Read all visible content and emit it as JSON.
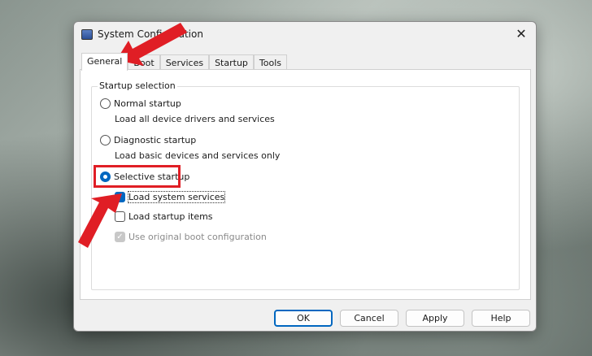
{
  "window": {
    "title": "System Configuration",
    "close_label": "✕"
  },
  "tabs": [
    {
      "label": "General"
    },
    {
      "label": "Boot"
    },
    {
      "label": "Services"
    },
    {
      "label": "Startup"
    },
    {
      "label": "Tools"
    }
  ],
  "startup_selection": {
    "label": "Startup selection",
    "normal": {
      "label": "Normal startup",
      "desc": "Load all device drivers and services"
    },
    "diagnostic": {
      "label": "Diagnostic startup",
      "desc": "Load basic devices and services only"
    },
    "selective": {
      "label": "Selective startup",
      "selected": true
    },
    "options": [
      {
        "label": "Load system services",
        "checked": true
      },
      {
        "label": "Load startup items",
        "checked": false
      },
      {
        "label": "Use original boot configuration",
        "checked": true,
        "disabled": true
      }
    ]
  },
  "buttons": {
    "ok": "OK",
    "cancel": "Cancel",
    "apply": "Apply",
    "help": "Help"
  },
  "annotation_color": "#e01e25"
}
